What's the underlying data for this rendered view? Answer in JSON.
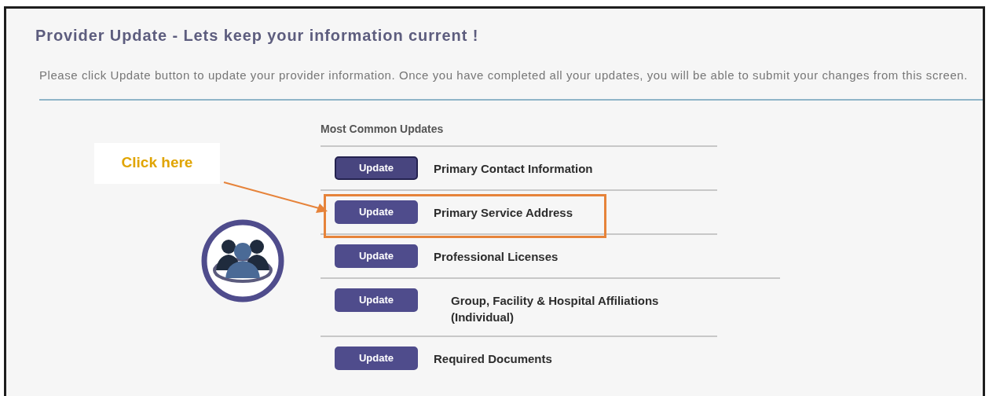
{
  "title": "Provider Update - Lets keep your information current !",
  "instructions": "Please click Update button to update your provider information. Once you have completed all your updates, you will be able to submit your changes from this screen.",
  "section_heading": "Most Common Updates",
  "callout": {
    "text": "Click here"
  },
  "updates": [
    {
      "button": "Update",
      "label": "Primary Contact Information",
      "focused": true,
      "highlighted": false
    },
    {
      "button": "Update",
      "label": "Primary Service Address",
      "focused": false,
      "highlighted": true
    },
    {
      "button": "Update",
      "label": "Professional Licenses",
      "focused": false,
      "highlighted": false
    },
    {
      "button": "Update",
      "label": "Group, Facility & Hospital Affiliations (Individual)",
      "focused": false,
      "highlighted": false
    },
    {
      "button": "Update",
      "label": "Required Documents",
      "focused": false,
      "highlighted": false
    }
  ]
}
